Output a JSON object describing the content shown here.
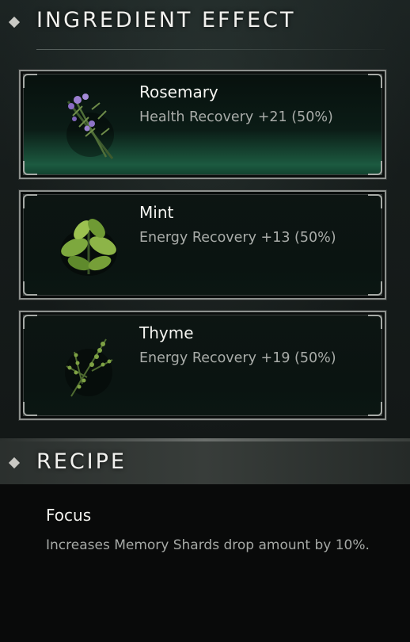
{
  "ingredient_section": {
    "title": "INGREDIENT EFFECT",
    "ingredients": [
      {
        "name": "Rosemary",
        "effect": "Health Recovery +21 (50%)",
        "icon": "rosemary-icon",
        "selected": true
      },
      {
        "name": "Mint",
        "effect": "Energy Recovery +13 (50%)",
        "icon": "mint-icon",
        "selected": false
      },
      {
        "name": "Thyme",
        "effect": "Energy Recovery +19 (50%)",
        "icon": "thyme-icon",
        "selected": false
      }
    ]
  },
  "recipe_section": {
    "title": "RECIPE",
    "recipe_name": "Focus",
    "recipe_description": "Increases Memory Shards drop amount by 10%."
  },
  "colors": {
    "accent_green": "#1c5a40",
    "frame_silver": "#8d918e"
  }
}
